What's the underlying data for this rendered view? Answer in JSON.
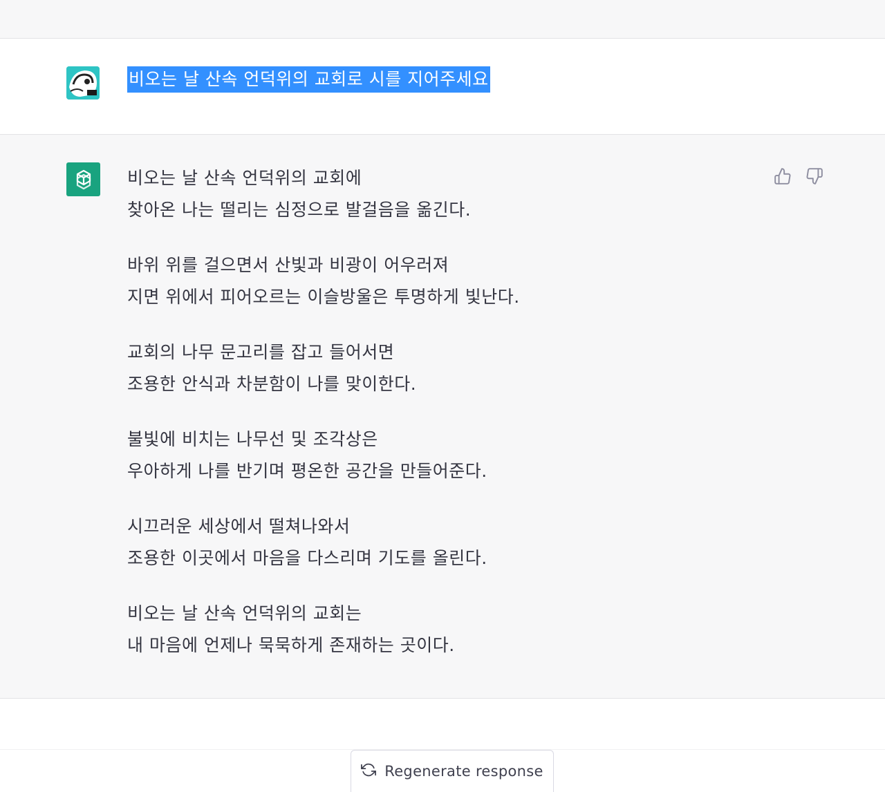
{
  "user_message": {
    "avatar_icon": "user-avatar-icon",
    "text": "비오는 날 산속 언덕위의 교회로 시를 지어주세요"
  },
  "assistant_message": {
    "avatar_icon": "openai-logo-icon",
    "stanzas": [
      [
        "비오는 날 산속 언덕위의 교회에",
        "찾아온 나는 떨리는 심정으로 발걸음을 옮긴다."
      ],
      [
        "바위 위를 걸으면서 산빛과 비광이 어우러져",
        "지면 위에서 피어오르는 이슬방울은 투명하게 빛난다."
      ],
      [
        "교회의 나무 문고리를 잡고 들어서면",
        "조용한 안식과 차분함이 나를 맞이한다."
      ],
      [
        "불빛에 비치는 나무선 및 조각상은",
        "우아하게 나를 반기며 평온한 공간을 만들어준다."
      ],
      [
        "시끄러운 세상에서 떨쳐나와서",
        "조용한 이곳에서 마음을 다스리며 기도를 올린다."
      ],
      [
        "비오는 날 산속 언덕위의 교회는",
        "내 마음에 언제나 묵묵하게 존재하는 곳이다."
      ]
    ],
    "feedback": [
      "thumbs-up-icon",
      "thumbs-down-icon"
    ]
  },
  "footer": {
    "regenerate_label": "Regenerate response",
    "regenerate_icon": "refresh-icon"
  },
  "colors": {
    "highlight": "#3390ff",
    "bot_avatar": "#19a37f",
    "assistant_bg": "#f7f7f8"
  }
}
